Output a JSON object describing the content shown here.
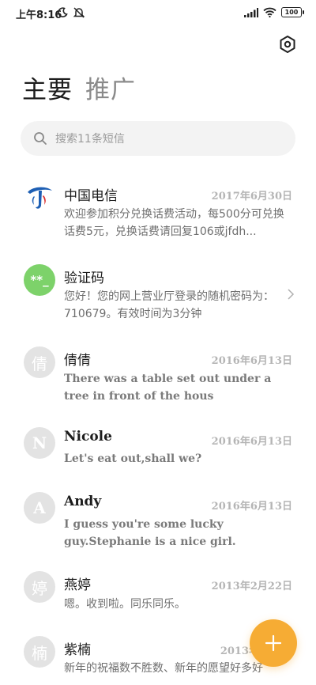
{
  "status_bar": {
    "time": "上午8:16",
    "battery": "100",
    "icons": [
      "moon-icon",
      "mute-icon",
      "signal-icon",
      "wifi-icon",
      "battery-icon"
    ]
  },
  "header": {
    "tabs": [
      {
        "label": "主要",
        "active": true
      },
      {
        "label": "推广",
        "active": false
      }
    ],
    "settings_icon": "hexagon-settings-icon"
  },
  "search": {
    "placeholder": "搜索11条短信"
  },
  "messages": [
    {
      "sender": "中国电信",
      "date": "2017年6月30日",
      "preview": "欢迎参加积分兑换话费活动，每500分可兑换话费5元，兑换话费请回复106或jfdh...",
      "avatar": "china-telecom-logo"
    },
    {
      "sender": "验证码",
      "date": "",
      "preview": "您好！您的网上营业厅登录的随机密码为：710679。有效时间为3分钟",
      "avatar_text": "**_",
      "avatar_color": "#7dd26a"
    },
    {
      "sender": "倩倩",
      "date": "2016年6月13日",
      "preview": "There was a table set out under a tree in front of the hous",
      "avatar_text": "倩"
    },
    {
      "sender": "Nicole",
      "date": "2016年6月13日",
      "preview": "Let's eat out,shall we?",
      "avatar_text": "N"
    },
    {
      "sender": "Andy",
      "date": "2016年6月13日",
      "preview": "I guess you're some lucky guy.Stephanie is a nice girl.",
      "avatar_text": "A"
    },
    {
      "sender": "燕婷",
      "date": "2013年2月22日",
      "preview": "嗯。收到啦。同乐同乐。",
      "avatar_text": "婷"
    },
    {
      "sender": "紫楠",
      "date": "2013年",
      "preview": "新年的祝福数不胜数、新年的愿望好多好",
      "avatar_text": "楠"
    }
  ],
  "fab": {
    "icon": "plus-icon",
    "color": "#f6ac34"
  }
}
